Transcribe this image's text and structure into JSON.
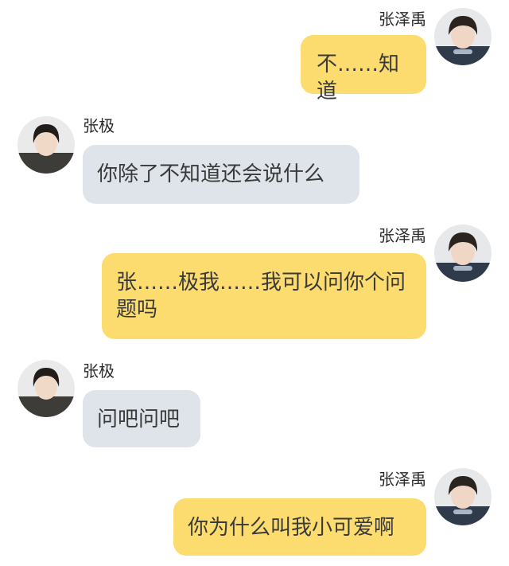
{
  "messages": [
    {
      "sender": "张泽禹",
      "side": "right",
      "text": "不……知道"
    },
    {
      "sender": "张极",
      "side": "left",
      "text": "你除了不知道还会说什么"
    },
    {
      "sender": "张泽禹",
      "side": "right",
      "text": "张……极我……我可以问你个问题吗"
    },
    {
      "sender": "张极",
      "side": "left",
      "text": "问吧问吧"
    },
    {
      "sender": "张泽禹",
      "side": "right",
      "text": "你为什么叫我小可爱啊"
    }
  ],
  "colors": {
    "my_bubble": "#fcdc6e",
    "other_bubble": "#dfe4ea",
    "background": "#ffffff"
  },
  "icons": {
    "avatar": "user-avatar-photo"
  }
}
